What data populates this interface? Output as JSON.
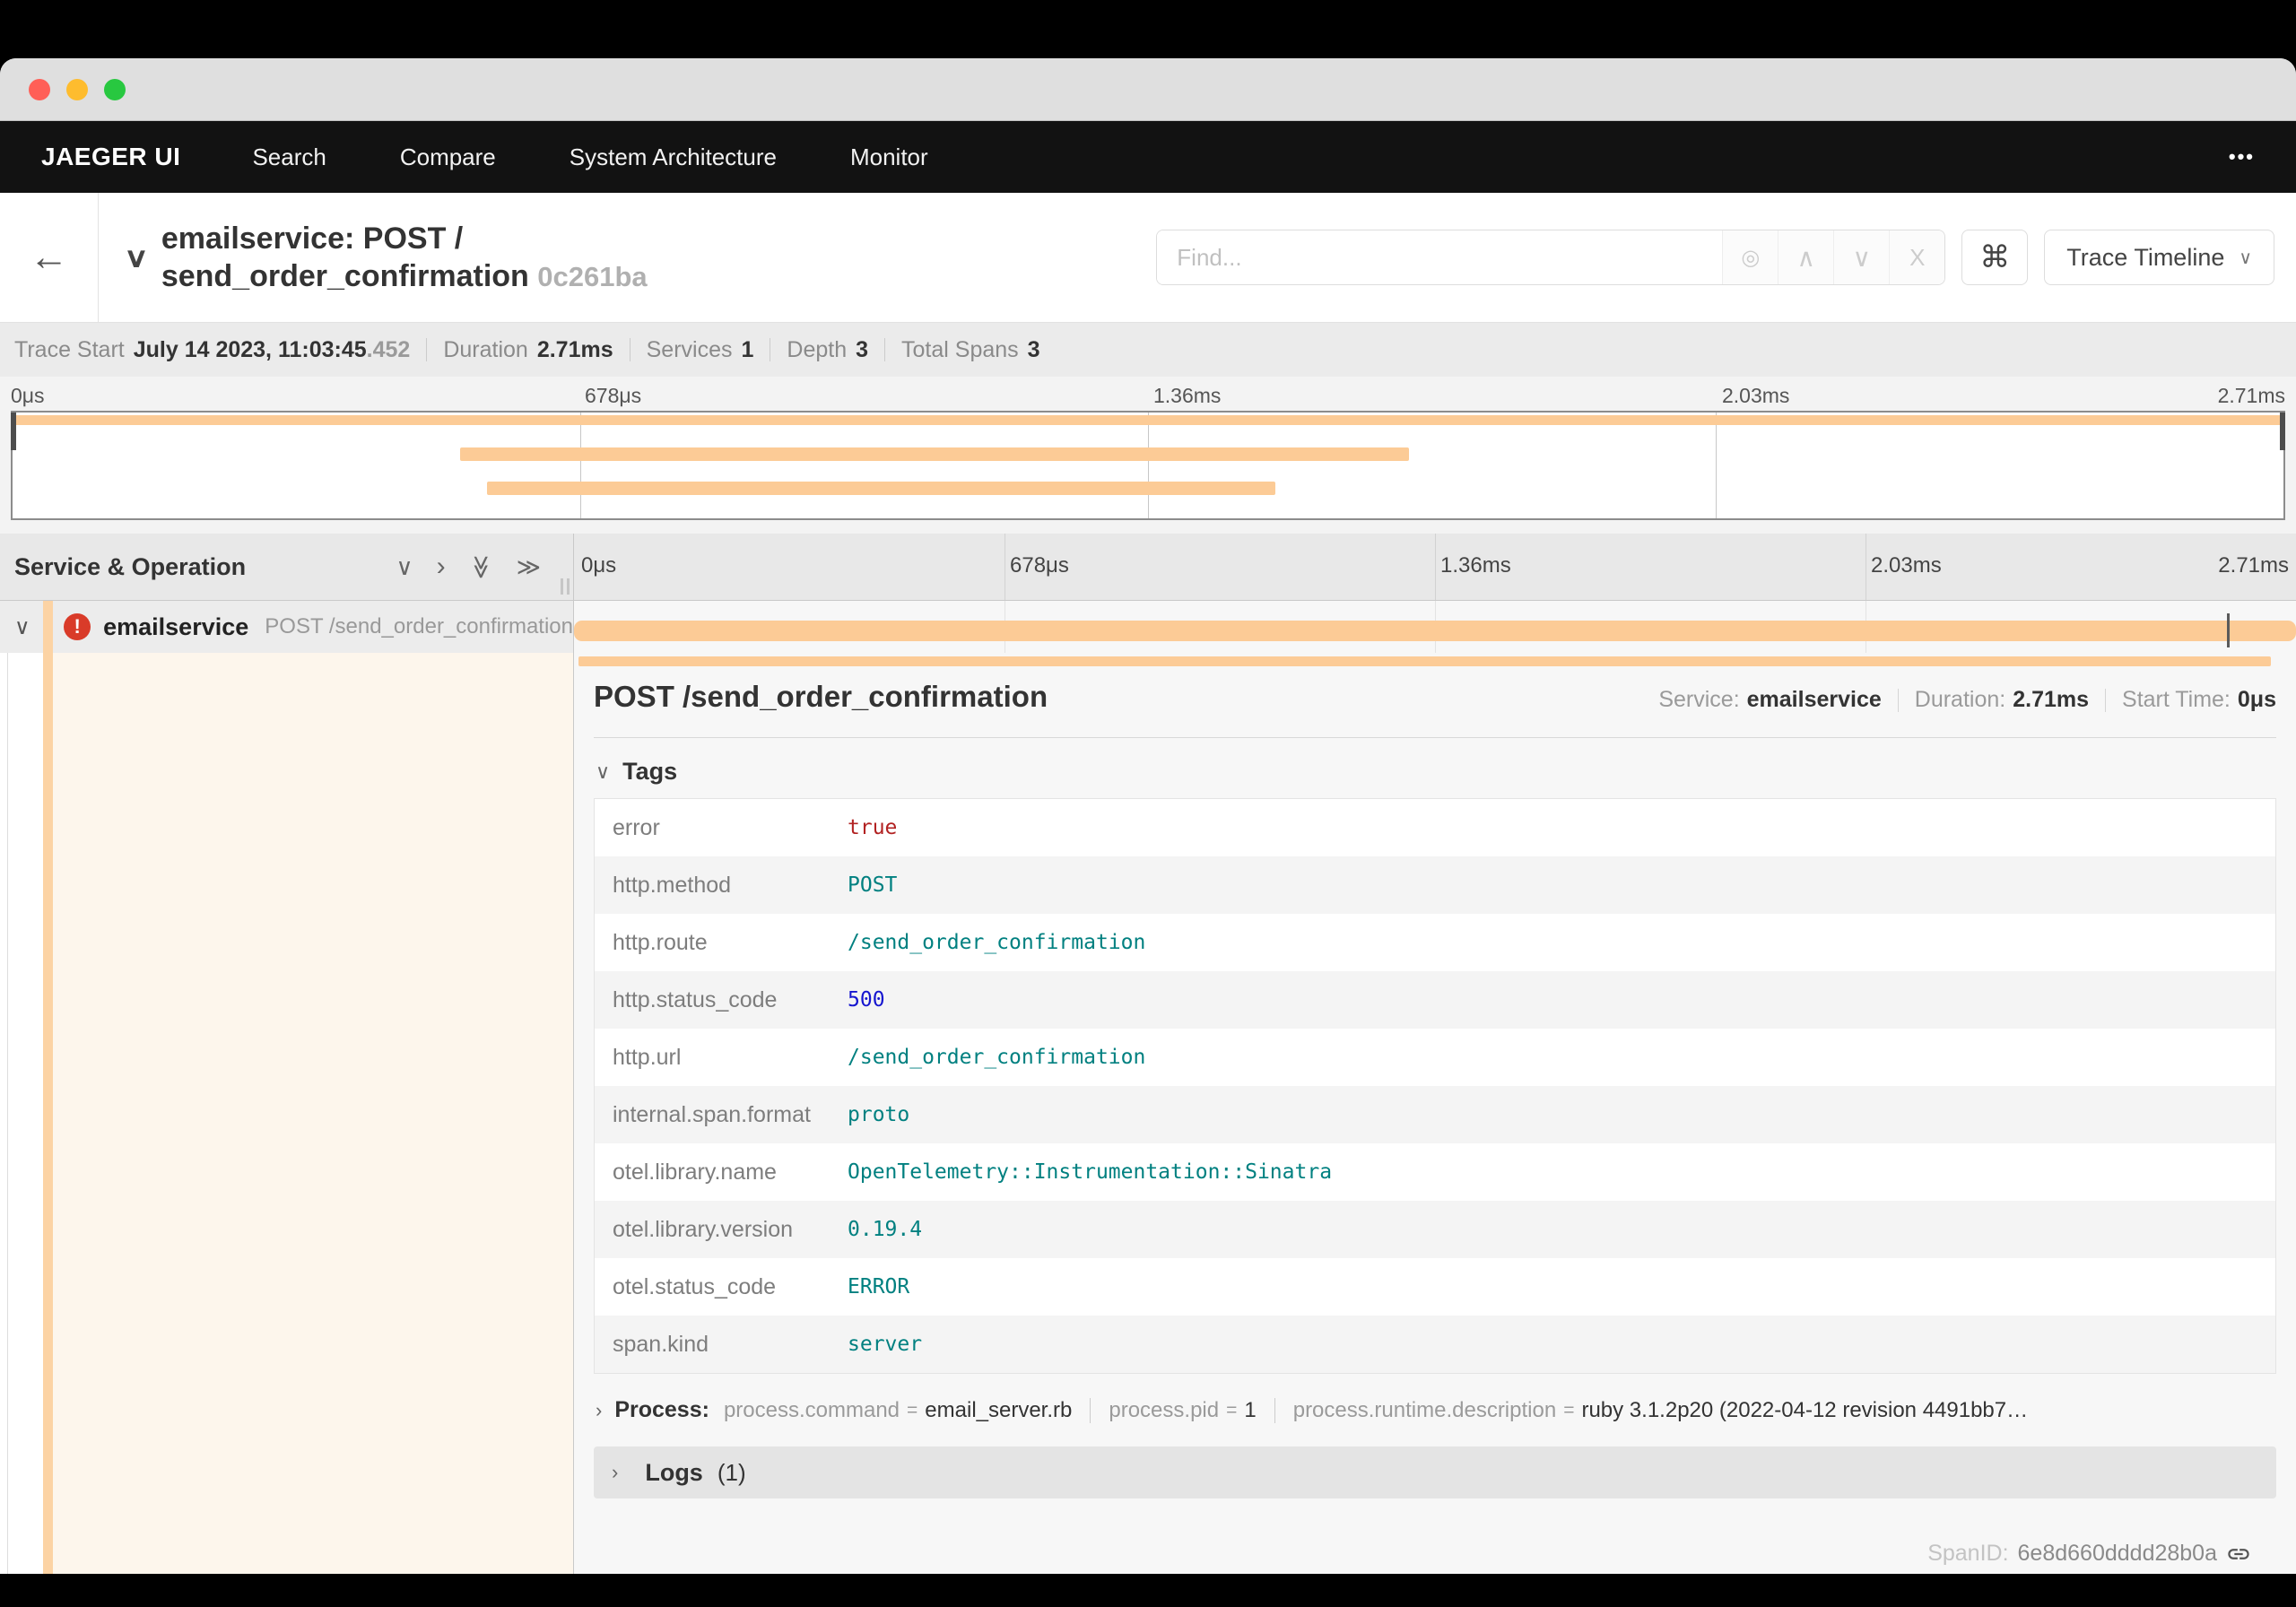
{
  "window": {
    "traffic_lights": [
      "close",
      "minimize",
      "zoom"
    ]
  },
  "navbar": {
    "brand": "JAEGER UI",
    "items": [
      {
        "label": "Search"
      },
      {
        "label": "Compare"
      },
      {
        "label": "System Architecture"
      },
      {
        "label": "Monitor"
      }
    ],
    "more_icon": "•••"
  },
  "trace_header": {
    "back_icon": "←",
    "collapse_icon": "∨",
    "title_line1": "emailservice: POST /",
    "title_line2": "send_order_confirmation",
    "trace_id": "0c261ba",
    "find": {
      "placeholder": "Find...",
      "value": "",
      "target_icon": "◎",
      "prev_icon": "∧",
      "next_icon": "∨",
      "clear_icon": "X"
    },
    "shortcut_icon": "⌘",
    "view_dropdown": {
      "label": "Trace Timeline",
      "chevron": "∨"
    }
  },
  "summary": {
    "items": [
      {
        "label": "Trace Start",
        "value": "July 14 2023, 11:03:45",
        "suffix": ".452"
      },
      {
        "label": "Duration",
        "value": "2.71ms",
        "suffix": ""
      },
      {
        "label": "Services",
        "value": "1",
        "suffix": ""
      },
      {
        "label": "Depth",
        "value": "3",
        "suffix": ""
      },
      {
        "label": "Total Spans",
        "value": "3",
        "suffix": ""
      }
    ]
  },
  "minimap": {
    "ticks": [
      "0μs",
      "678μs",
      "1.36ms",
      "2.03ms",
      "2.71ms"
    ],
    "bars": [
      {
        "start": 0,
        "end": 100
      },
      {
        "start": 19.7,
        "end": 61.5
      },
      {
        "start": 20.9,
        "end": 55.6
      }
    ]
  },
  "timeline": {
    "left_header": "Service & Operation",
    "collapse_icons": {
      "down": "∨",
      "right": "›",
      "double_down": "≫",
      "double_right": "≫"
    },
    "ticks": [
      "0μs",
      "678μs",
      "1.36ms",
      "2.03ms",
      "2.71ms"
    ]
  },
  "span_row": {
    "chevron": "∨",
    "error_glyph": "!",
    "service": "emailservice",
    "operation": "POST /send_order_confirmation",
    "bar": {
      "start": 0,
      "end": 100
    },
    "tick": {
      "start": 96.0,
      "end": 96.15
    }
  },
  "detail": {
    "title": "POST /send_order_confirmation",
    "meta": [
      {
        "label": "Service:",
        "value": "emailservice"
      },
      {
        "label": "Duration:",
        "value": "2.71ms"
      },
      {
        "label": "Start Time:",
        "value": "0μs"
      }
    ],
    "tags": {
      "chevron": "∨",
      "header": "Tags",
      "rows": [
        {
          "key": "error",
          "value": "true",
          "vtype": "bool"
        },
        {
          "key": "http.method",
          "value": "POST",
          "vtype": "string"
        },
        {
          "key": "http.route",
          "value": "/send_order_confirmation",
          "vtype": "string"
        },
        {
          "key": "http.status_code",
          "value": "500",
          "vtype": "number"
        },
        {
          "key": "http.url",
          "value": "/send_order_confirmation",
          "vtype": "string"
        },
        {
          "key": "internal.span.format",
          "value": "proto",
          "vtype": "string"
        },
        {
          "key": "otel.library.name",
          "value": "OpenTelemetry::Instrumentation::Sinatra",
          "vtype": "string"
        },
        {
          "key": "otel.library.version",
          "value": "0.19.4",
          "vtype": "string"
        },
        {
          "key": "otel.status_code",
          "value": "ERROR",
          "vtype": "string"
        },
        {
          "key": "span.kind",
          "value": "server",
          "vtype": "string"
        }
      ]
    },
    "process": {
      "chevron": "›",
      "label": "Process:",
      "kv": [
        {
          "key": "process.command",
          "value": "email_server.rb"
        },
        {
          "key": "process.pid",
          "value": "1"
        },
        {
          "key": "process.runtime.description",
          "value": "ruby 3.1.2p20 (2022-04-12 revision 4491bb7…"
        }
      ]
    },
    "logs": {
      "chevron": "›",
      "label": "Logs",
      "count": "(1)"
    },
    "span_id": {
      "label": "SpanID:",
      "value": "6e8d660dddd28b0a"
    }
  },
  "colors": {
    "span_bar": "#fccb96",
    "span_band": "#fcd3a4",
    "error_badge": "#d93b29",
    "tag_string": "#008080",
    "tag_number": "#1616cf",
    "tag_bool": "#b22222",
    "navbar_bg": "#121212"
  }
}
